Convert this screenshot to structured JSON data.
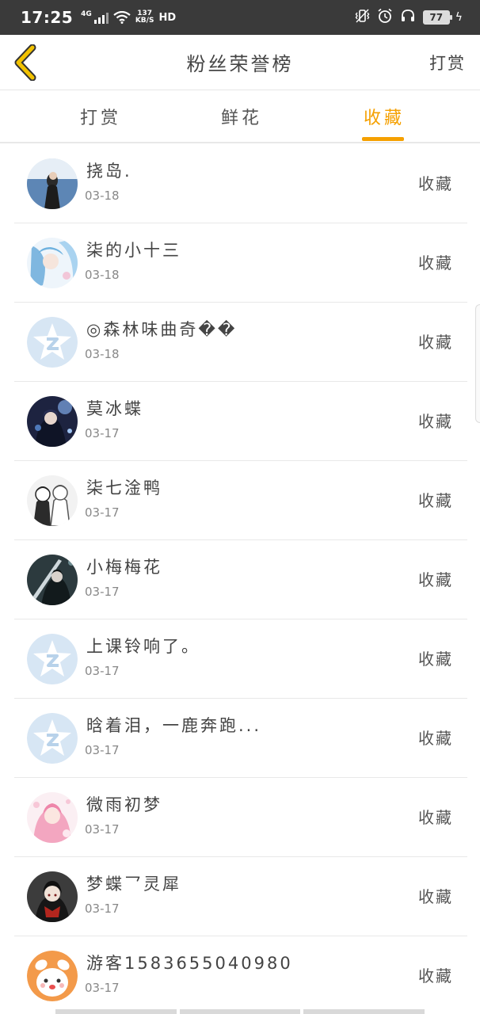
{
  "status_bar": {
    "time": "17:25",
    "network": "4G",
    "speed_value": "137",
    "speed_unit": "KB/S",
    "hd": "HD",
    "battery": "77"
  },
  "nav": {
    "title": "粉丝荣誉榜",
    "action": "打赏"
  },
  "tabs": [
    {
      "label": "打赏",
      "active": false
    },
    {
      "label": "鲜花",
      "active": false
    },
    {
      "label": "收藏",
      "active": true
    }
  ],
  "colors": {
    "accent": "#f5a000",
    "back_arrow": "#f2c200"
  },
  "fans": [
    {
      "name": "挠岛.",
      "date": "03-18",
      "action": "收藏",
      "avatar": "photo-girl-sea"
    },
    {
      "name": "柒的小十三",
      "date": "03-18",
      "action": "收藏",
      "avatar": "anime-blue-hair"
    },
    {
      "name": "◎森林味曲奇��",
      "date": "03-18",
      "action": "收藏",
      "avatar": "default-star"
    },
    {
      "name": "莫冰蝶",
      "date": "03-17",
      "action": "收藏",
      "avatar": "anime-night"
    },
    {
      "name": "柒七淦鸭",
      "date": "03-17",
      "action": "收藏",
      "avatar": "anime-couple-sketch"
    },
    {
      "name": "小梅梅花",
      "date": "03-17",
      "action": "收藏",
      "avatar": "anime-dark-swordsman"
    },
    {
      "name": "上课铃响了。",
      "date": "03-17",
      "action": "收藏",
      "avatar": "default-star"
    },
    {
      "name": "晗着泪，一鹿奔跑...",
      "date": "03-17",
      "action": "收藏",
      "avatar": "default-star"
    },
    {
      "name": "微雨初梦",
      "date": "03-17",
      "action": "收藏",
      "avatar": "anime-pink-girl"
    },
    {
      "name": "梦蝶乛灵犀",
      "date": "03-17",
      "action": "收藏",
      "avatar": "anime-dark-girl"
    },
    {
      "name": "游客1583655040980",
      "date": "03-17",
      "action": "收藏",
      "avatar": "cartoon-bunny"
    }
  ]
}
